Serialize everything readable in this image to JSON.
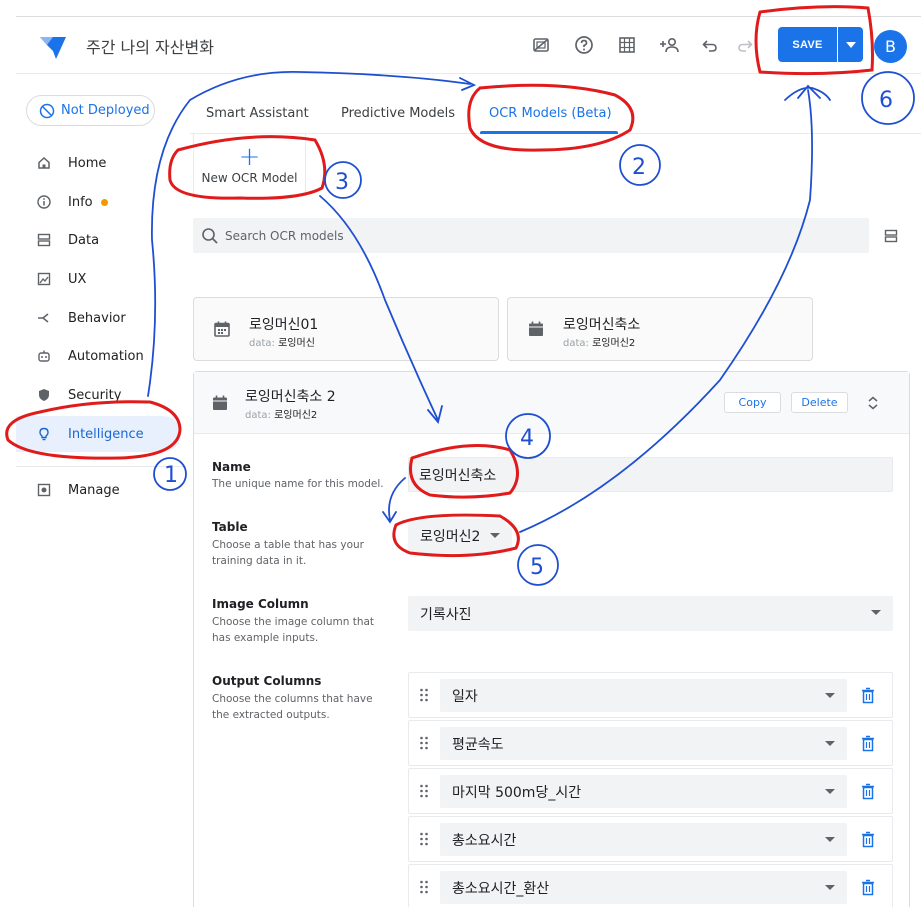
{
  "app": {
    "title": "주간 나의 자산변화",
    "save_label": "SAVE",
    "avatar_initial": "B"
  },
  "header_icons": [
    "preview-toggle-icon",
    "help-icon",
    "grid-icon",
    "add-person-icon",
    "undo-icon",
    "redo-icon"
  ],
  "deploy": {
    "label": "Not Deployed"
  },
  "sidebar": {
    "items": [
      {
        "label": "Home",
        "icon": "home-icon"
      },
      {
        "label": "Info",
        "icon": "info-icon"
      },
      {
        "label": "Data",
        "icon": "data-icon"
      },
      {
        "label": "UX",
        "icon": "ux-icon"
      },
      {
        "label": "Behavior",
        "icon": "behavior-icon"
      },
      {
        "label": "Automation",
        "icon": "automation-icon"
      },
      {
        "label": "Security",
        "icon": "security-icon"
      },
      {
        "label": "Intelligence",
        "icon": "lightbulb-icon"
      },
      {
        "label": "Manage",
        "icon": "manage-icon"
      }
    ],
    "active": "Intelligence"
  },
  "tabs": [
    {
      "label": "Smart Assistant"
    },
    {
      "label": "Predictive Models"
    },
    {
      "label": "OCR Models (Beta)"
    }
  ],
  "new_model": {
    "label": "New OCR Model"
  },
  "search": {
    "placeholder": "Search OCR models"
  },
  "cards": [
    {
      "title": "로잉머신01",
      "data_prefix": "data:",
      "data_value": "로잉머신"
    },
    {
      "title": "로잉머신축소",
      "data_prefix": "data:",
      "data_value": "로잉머신2"
    }
  ],
  "expanded": {
    "title": "로잉머신축소 2",
    "data_prefix": "data:",
    "data_value": "로잉머신2",
    "copy_label": "Copy",
    "delete_label": "Delete",
    "fields": {
      "name": {
        "label": "Name",
        "desc": "The unique name for this model.",
        "value": "로잉머신축소"
      },
      "table": {
        "label": "Table",
        "desc": "Choose a table that has your training data in it.",
        "value": "로잉머신2"
      },
      "image_column": {
        "label": "Image Column",
        "desc": "Choose the image column that has example inputs.",
        "value": "기록사진"
      },
      "output_columns": {
        "label": "Output Columns",
        "desc": "Choose the columns that have the extracted outputs.",
        "values": [
          "일자",
          "평균속도",
          "마지막 500m당_시간",
          "총소요시간",
          "총소요시간_환산"
        ]
      }
    }
  },
  "annotations": [
    "1",
    "2",
    "3",
    "4",
    "5",
    "6"
  ],
  "colors": {
    "accent": "#1a73e8",
    "annotation_red": "#e01b1b",
    "annotation_blue": "#1f4fd1",
    "info_dot": "#f29900"
  }
}
